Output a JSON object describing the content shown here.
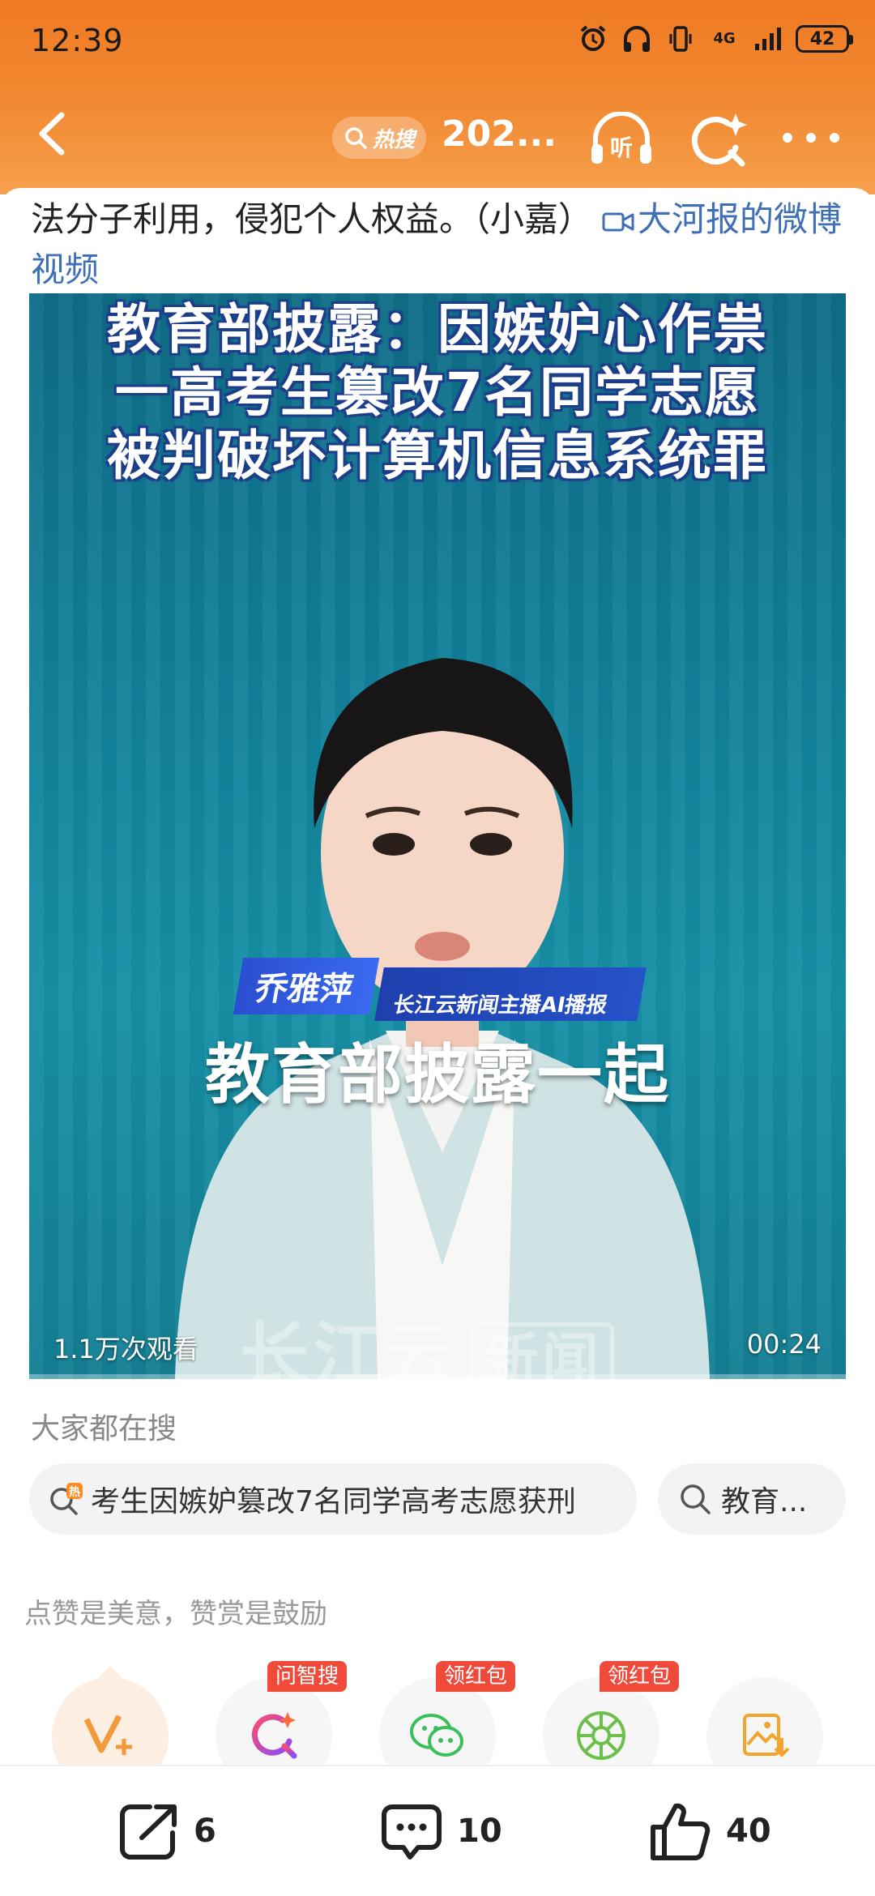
{
  "status_bar": {
    "time": "12:39",
    "network": "4G",
    "battery": "42"
  },
  "nav": {
    "hot_label": "热搜",
    "title": "202...",
    "listen_label": "听"
  },
  "article": {
    "text": "法分子利用，侵犯个人权益。（小嘉）",
    "link_text": "大河报的微博视频"
  },
  "video": {
    "headline": [
      "教育部披露：因嫉妒心作祟",
      "一高考生篡改7名同学志愿",
      "被判破坏计算机信息系统罪"
    ],
    "anchor_name": "乔雅萍",
    "anchor_org": "长江云新闻主播AI播报",
    "subtitle": "教育部披露一起",
    "watermark_main": "长江云",
    "watermark_box": "新闻",
    "views": "1.1万次观看",
    "duration": "00:24",
    "progress": 0
  },
  "search": {
    "title": "大家都在搜",
    "chips": [
      {
        "text": "考生因嫉妒篡改7名同学高考志愿获刑",
        "icon": "hot-search-icon"
      },
      {
        "text": "教育...",
        "icon": "search-icon"
      }
    ]
  },
  "encourage_text": "点赞是美意，赞赏是鼓励",
  "actions": [
    {
      "name": "reward",
      "icon": "v-plus-icon",
      "tag": ""
    },
    {
      "name": "ai-search",
      "icon": "ai-search-icon",
      "tag": "问智搜"
    },
    {
      "name": "wechat",
      "icon": "wechat-icon",
      "tag": "领红包"
    },
    {
      "name": "moments",
      "icon": "moments-icon",
      "tag": "领红包"
    },
    {
      "name": "save-image",
      "icon": "save-image-icon",
      "tag": ""
    }
  ],
  "bottom_bar": {
    "share_count": "6",
    "comment_count": "10",
    "like_count": "40"
  },
  "colors": {
    "header_orange": "#f07a23",
    "link_blue": "#3f6fb6",
    "tag_red": "#f04a3a",
    "video_teal": "#12809a"
  }
}
